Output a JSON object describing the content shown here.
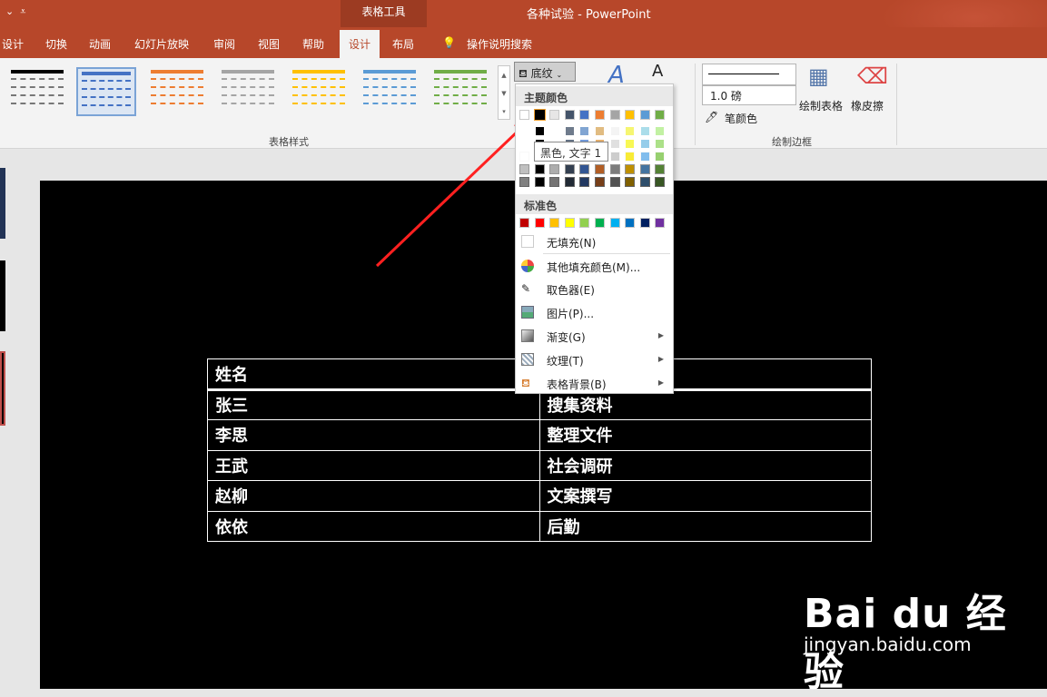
{
  "titlebar": {
    "context_tab": "表格工具",
    "title": "各种试验  -  PowerPoint"
  },
  "tabs": [
    {
      "label": "设计"
    },
    {
      "label": "切换"
    },
    {
      "label": "动画"
    },
    {
      "label": "幻灯片放映"
    },
    {
      "label": "审阅"
    },
    {
      "label": "视图"
    },
    {
      "label": "帮助"
    },
    {
      "label": "设计"
    },
    {
      "label": "布局"
    }
  ],
  "search": {
    "label": "操作说明搜索"
  },
  "ribbon": {
    "table_styles_label": "表格样式",
    "shading_label": "底纹",
    "line_weight": "1.0 磅",
    "pen_color": "笔颜色",
    "draw_table": "绘制表格",
    "eraser": "橡皮擦",
    "draw_borders_label": "绘制边框"
  },
  "dropdown": {
    "theme_colors_label": "主题颜色",
    "standard_colors_label": "标准色",
    "tooltip": "黑色, 文字 1",
    "no_fill": "无填充(N)",
    "more_colors": "其他填充颜色(M)...",
    "eyedropper": "取色器(E)",
    "picture": "图片(P)...",
    "gradient": "渐变(G)",
    "texture": "纹理(T)",
    "table_background": "表格背景(B)",
    "theme_row": [
      "#ffffff",
      "#000000",
      "#e7e6e6",
      "#44546a",
      "#4472c4",
      "#ed7d31",
      "#a5a5a5",
      "#ffc000",
      "#5b9bd5",
      "#70ad47"
    ],
    "standard_row": [
      "#c00000",
      "#ff0000",
      "#ffc000",
      "#ffff00",
      "#92d050",
      "#00b050",
      "#00b0f0",
      "#0070c0",
      "#002060",
      "#7030a0"
    ]
  },
  "table": {
    "rows": [
      [
        "姓名",
        ""
      ],
      [
        "张三",
        "搜集资料"
      ],
      [
        "李思",
        "整理文件"
      ],
      [
        "王武",
        "社会调研"
      ],
      [
        "赵柳",
        "文案撰写"
      ],
      [
        "依依",
        "后勤"
      ]
    ]
  },
  "watermark": {
    "logo": "Bai du 经验",
    "url": "jingyan.baidu.com"
  },
  "colors": {
    "accent": "#b7472a",
    "slide_bg": "#000000"
  }
}
